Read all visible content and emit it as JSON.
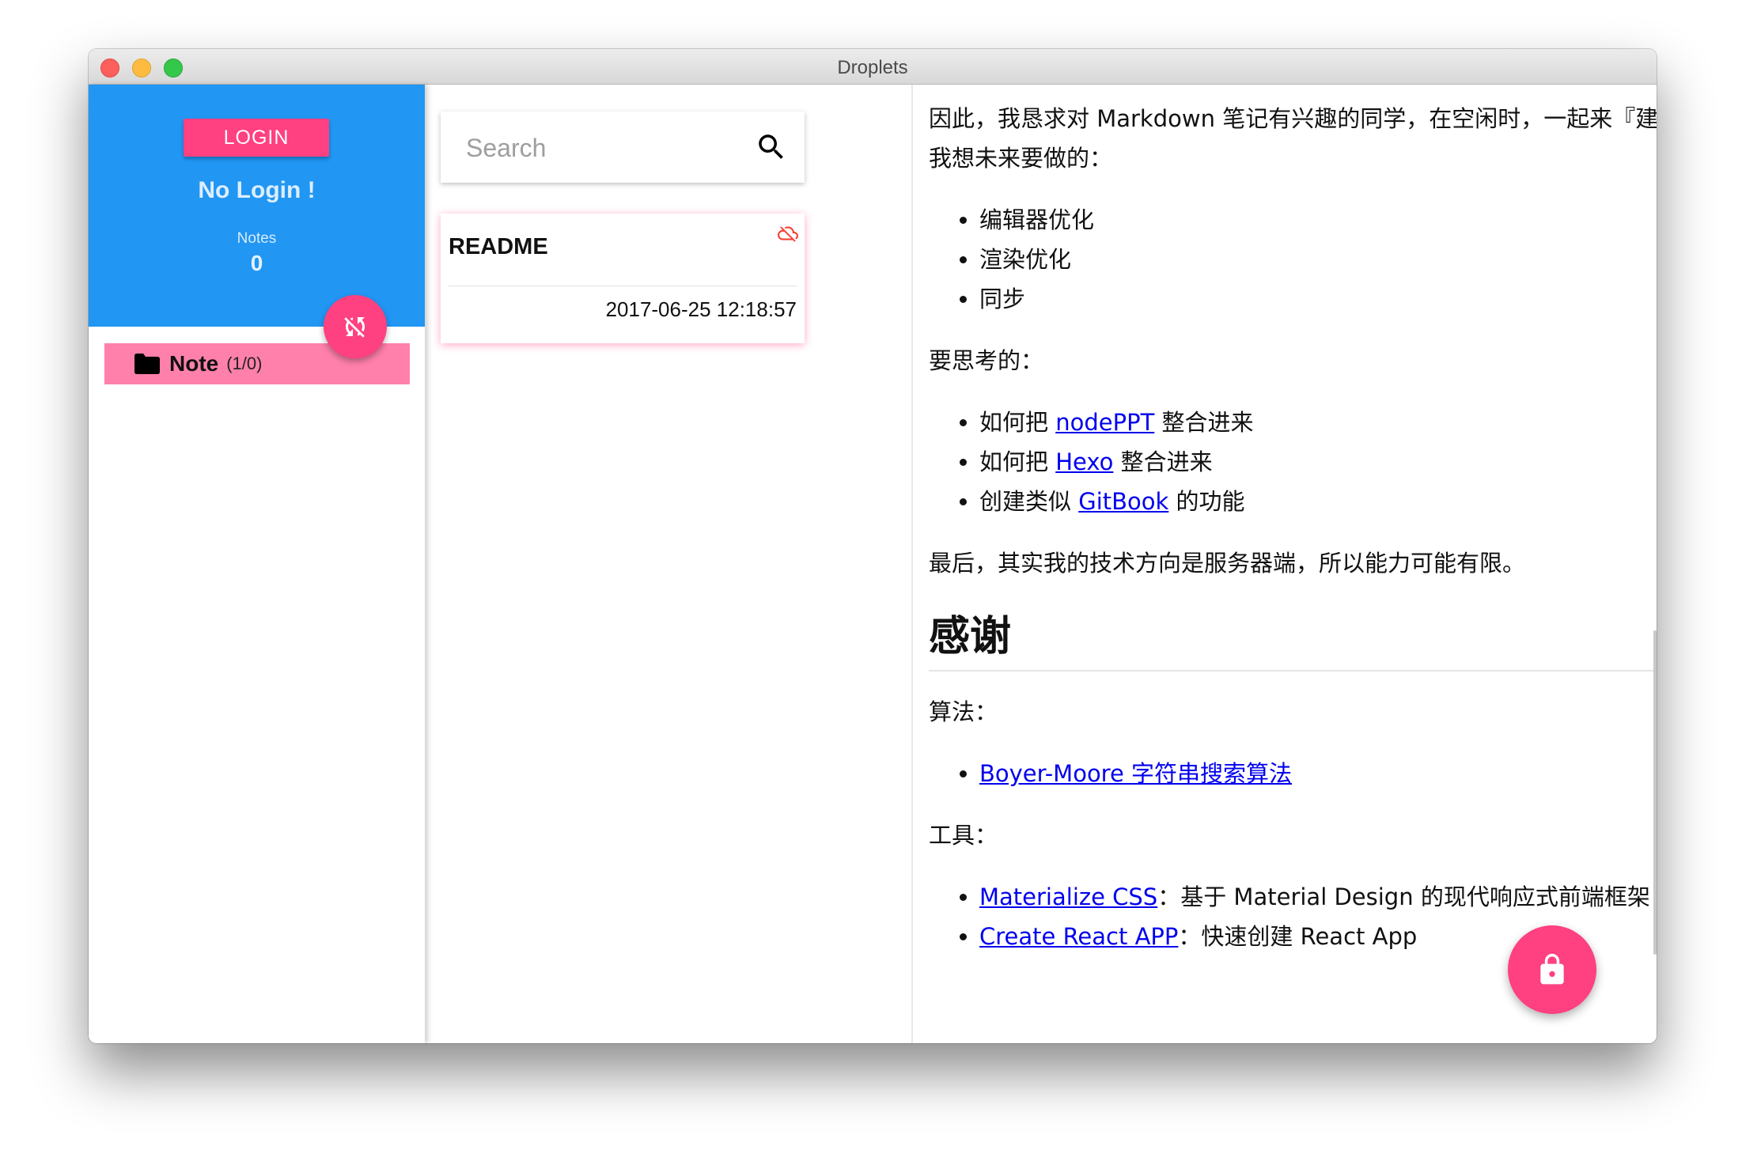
{
  "window": {
    "title": "Droplets"
  },
  "sidebar": {
    "login_label": "LOGIN",
    "login_status": "No Login !",
    "notes_label": "Notes",
    "notes_count": "0",
    "folder": {
      "name": "Note",
      "count": "(1/0)"
    }
  },
  "search": {
    "placeholder": "Search"
  },
  "notes": [
    {
      "title": "README",
      "date": "2017-06-25 12:18:57",
      "sync_status": "cloud-off-icon"
    }
  ],
  "preview": {
    "p1": "因此，我恳求对 Markdown 笔记有兴趣的同学，在空闲时，一起来『建筑』。我想未来要做的：",
    "todo": [
      "编辑器优化",
      "渲染优化",
      "同步"
    ],
    "p2": "要思考的：",
    "think": [
      {
        "pre": "如何把 ",
        "link": "nodePPT",
        "post": " 整合进来"
      },
      {
        "pre": "如何把 ",
        "link": "Hexo",
        "post": " 整合进来"
      },
      {
        "pre": "创建类似 ",
        "link": "GitBook",
        "post": " 的功能"
      }
    ],
    "p3": "最后，其实我的技术方向是服务器端，所以能力可能有限。",
    "h_thanks": "感谢",
    "p_algo": "算法：",
    "algo_link": "Boyer-Moore 字符串搜索算法",
    "p_tools": "工具：",
    "tools": [
      {
        "link": "Materialize CSS",
        "post": "：基于 Material Design 的现代响应式前端框架"
      },
      {
        "link": "Create React APP",
        "post": "：快速创建 React App"
      }
    ]
  },
  "colors": {
    "primary": "#2196f3",
    "accent": "#ff4081",
    "folder_highlight": "#ff80ab",
    "link": "#0000ee"
  },
  "icons": {
    "sync_fab": "sync-disabled-icon",
    "lock_fab": "lock-icon",
    "search": "search-icon",
    "folder": "folder-icon"
  }
}
